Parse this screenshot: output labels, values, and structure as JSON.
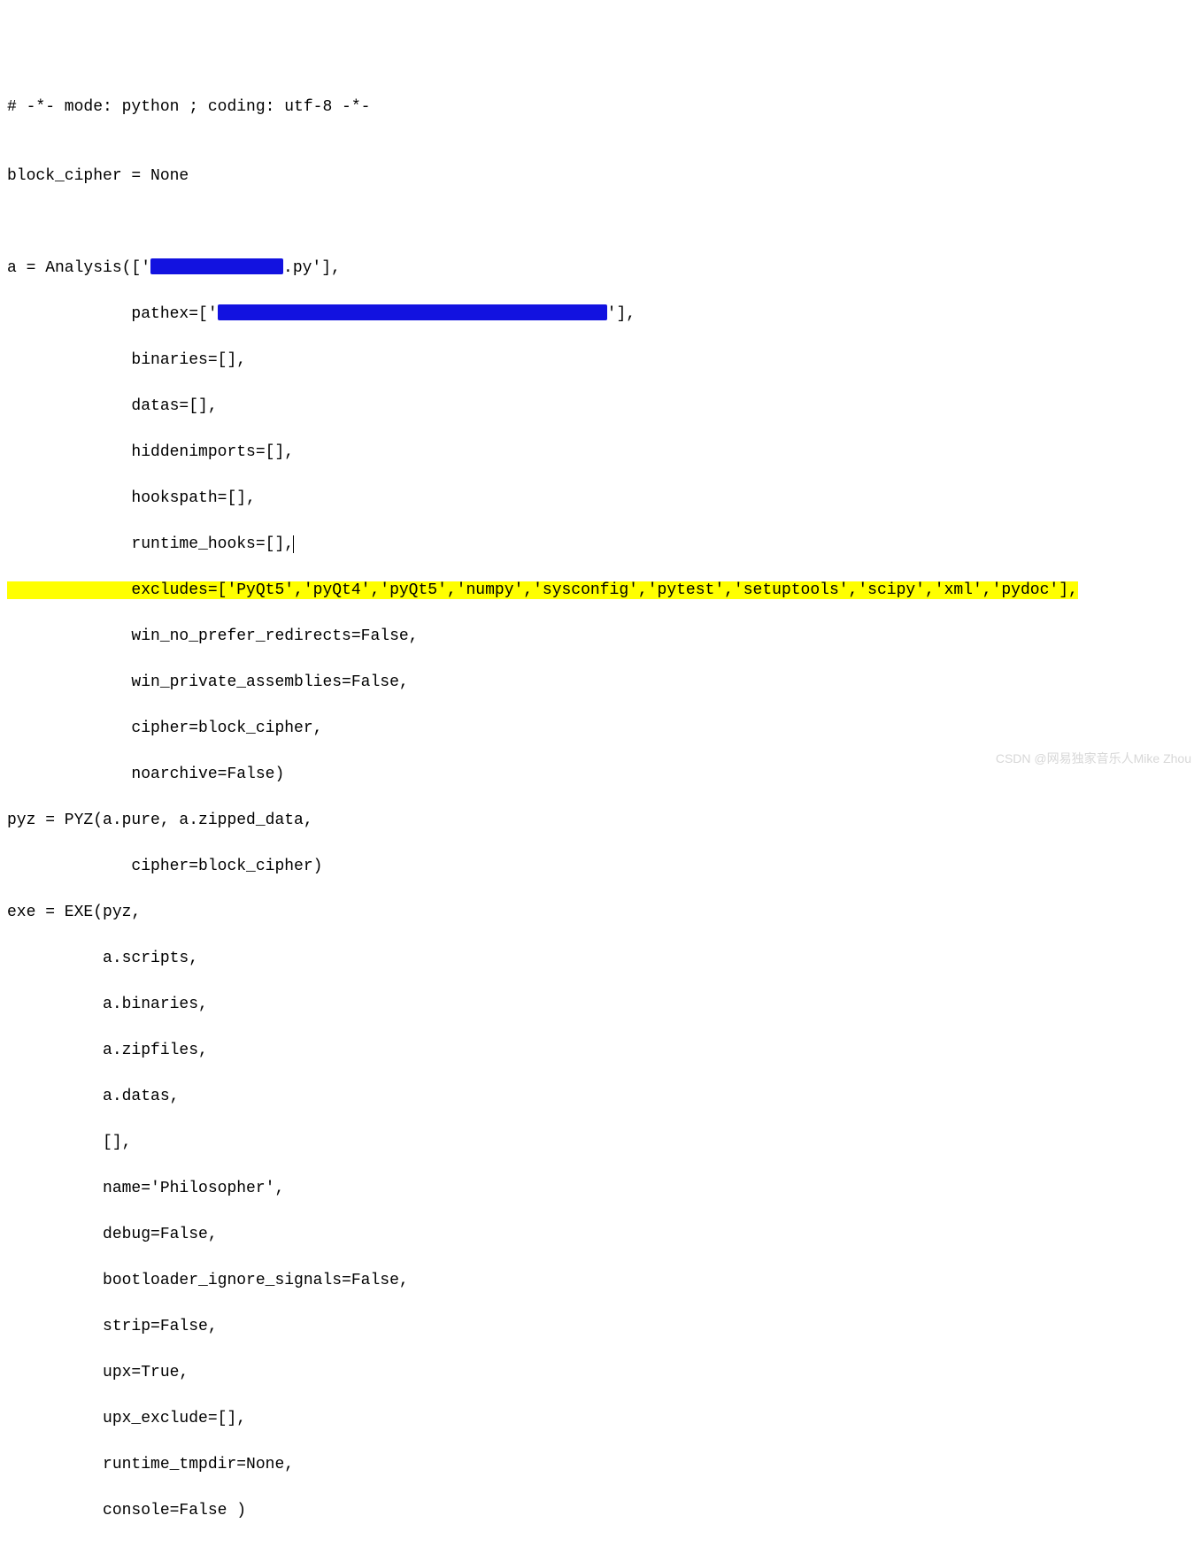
{
  "lines": {
    "l00": "# -*- mode: python ; coding: utf-8 -*-",
    "l01": "",
    "l02": "block_cipher = None",
    "l03": "",
    "l04": "",
    "l05a": "a = Analysis(['",
    "l05b": ".py'],",
    "l06a": "             pathex=['",
    "l06b": "'],",
    "l07": "             binaries=[],",
    "l08": "             datas=[],",
    "l09": "             hiddenimports=[],",
    "l10": "             hookspath=[],",
    "l11": "             runtime_hooks=[],",
    "l12": "             excludes=['PyQt5','pyQt4','pyQt5','numpy','sysconfig','pytest','setuptools','scipy','xml','pydoc'],",
    "l13": "             win_no_prefer_redirects=False,",
    "l14": "             win_private_assemblies=False,",
    "l15": "             cipher=block_cipher,",
    "l16": "             noarchive=False)",
    "l17": "pyz = PYZ(a.pure, a.zipped_data,",
    "l18": "             cipher=block_cipher)",
    "l19": "exe = EXE(pyz,",
    "l20": "          a.scripts,",
    "l21": "          a.binaries,",
    "l22": "          a.zipfiles,",
    "l23": "          a.datas,",
    "l24": "          [],",
    "l25": "          name='Philosopher',",
    "l26": "          debug=False,",
    "l27": "          bootloader_ignore_signals=False,",
    "l28": "          strip=False,",
    "l29": "          upx=True,",
    "l30": "          upx_exclude=[],",
    "l31": "          runtime_tmpdir=None,",
    "l32": "          console=False )"
  },
  "watermark": "CSDN @网易独家音乐人Mike Zhou"
}
